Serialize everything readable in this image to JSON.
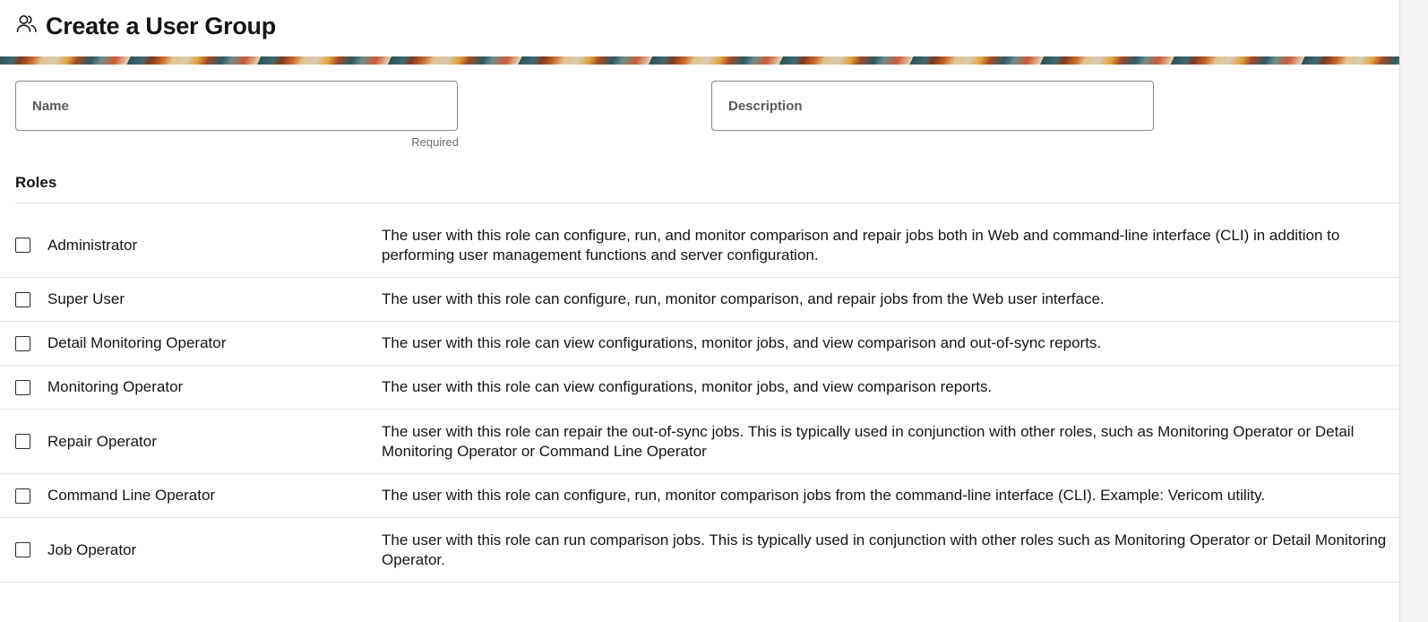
{
  "header": {
    "title": "Create a User Group",
    "icon": "users-icon"
  },
  "form": {
    "name": {
      "placeholder": "Name",
      "value": "",
      "hint": "Required"
    },
    "description": {
      "placeholder": "Description",
      "value": ""
    }
  },
  "roles": {
    "heading": "Roles",
    "items": [
      {
        "name": "Administrator",
        "checked": false,
        "description": "The user with this role can configure, run, and monitor comparison and repair jobs both in Web and command-line interface (CLI) in addition to performing user management functions and server configuration."
      },
      {
        "name": "Super User",
        "checked": false,
        "description": "The user with this role can configure, run, monitor comparison, and repair jobs from the Web user interface."
      },
      {
        "name": "Detail Monitoring Operator",
        "checked": false,
        "description": "The user with this role can view configurations, monitor jobs, and view comparison and out-of-sync reports."
      },
      {
        "name": "Monitoring Operator",
        "checked": false,
        "description": "The user with this role can view configurations, monitor jobs, and view comparison reports."
      },
      {
        "name": "Repair Operator",
        "checked": false,
        "description": "The user with this role can repair the out-of-sync jobs. This is typically used in conjunction with other roles, such as Monitoring Operator or Detail Monitoring Operator or Command Line Operator"
      },
      {
        "name": "Command Line Operator",
        "checked": false,
        "description": "The user with this role can configure, run, monitor comparison jobs from the command-line interface (CLI). Example: Vericom utility."
      },
      {
        "name": "Job Operator",
        "checked": false,
        "description": "The user with this role can run comparison jobs. This is typically used in conjunction with other roles such as Monitoring Operator or Detail Monitoring Operator."
      }
    ]
  }
}
